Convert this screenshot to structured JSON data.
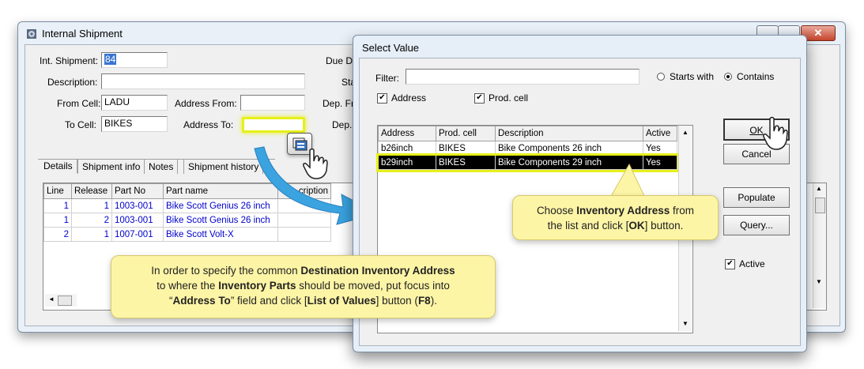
{
  "main_window": {
    "title": "Internal Shipment",
    "controls": {
      "minimize": "",
      "maximize": "",
      "close": "✕"
    },
    "fields": {
      "int_shipment_label": "Int. Shipment:",
      "int_shipment_value": "84",
      "description_label": "Description:",
      "description_value": "",
      "from_cell_label": "From Cell:",
      "from_cell_value": "LADU",
      "to_cell_label": "To Cell:",
      "to_cell_value": "BIKES",
      "address_from_label": "Address From:",
      "address_from_value": "",
      "address_to_label": "Address To:",
      "address_to_value": "",
      "due_date_label": "Due Da",
      "status_label": "Sta",
      "dep_from_label": "Dep. Fro",
      "dep_to_label": "Dep. T"
    },
    "tabs": [
      "Details",
      "Shipment info",
      "Notes",
      "Shipment history"
    ],
    "table": {
      "columns": [
        "Line",
        "Release",
        "Part No",
        "Part name",
        "cription"
      ],
      "rows": [
        {
          "line": "1",
          "release": "1",
          "part_no": "1003-001",
          "part_name": "Bike Scott Genius 26 inch"
        },
        {
          "line": "1",
          "release": "2",
          "part_no": "1003-001",
          "part_name": "Bike Scott Genius 26 inch"
        },
        {
          "line": "2",
          "release": "1",
          "part_no": "1007-001",
          "part_name": "Bike Scott Volt-X"
        }
      ]
    }
  },
  "dialog": {
    "title": "Select Value",
    "filter_label": "Filter:",
    "filter_value": "",
    "starts_with_label": "Starts with",
    "contains_label": "Contains",
    "address_check_label": "Address",
    "prod_cell_check_label": "Prod. cell",
    "columns": [
      "Address",
      "Prod. cell",
      "Description",
      "Active"
    ],
    "rows": [
      {
        "address": "b26inch",
        "prod_cell": "BIKES",
        "description": "Bike Components 26 inch",
        "active": "Yes"
      },
      {
        "address": "b29inch",
        "prod_cell": "BIKES",
        "description": "Bike Components 29 inch",
        "active": "Yes"
      }
    ],
    "buttons": {
      "ok": "OK",
      "cancel": "Cancel",
      "populate": "Populate",
      "query": "Query..."
    },
    "active_check_label": "Active"
  },
  "callouts": {
    "dialog_tip": {
      "line1_pre": "Choose ",
      "line1_bold": "Inventory Address",
      "line1_post": " from",
      "line2_pre": "the list and click [",
      "line2_bold": "OK",
      "line2_post": "] button."
    },
    "main_tip": {
      "line1_pre": "In order to specify the common ",
      "line1_bold": "Destination Inventory Address",
      "line2_pre": "to where the ",
      "line2_bold": "Inventory Parts",
      "line2_post": " should be moved, put focus into",
      "line3_q1": "“",
      "line3_bold": "Address To",
      "line3_mid": "” field and click [",
      "line3_bold2": "List of Values",
      "line3_mid2": "] button (",
      "line3_bold3": "F8",
      "line3_post": ")."
    }
  },
  "colors": {
    "selection": "#000000",
    "highlight": "#e6f01a",
    "callout": "#fdf5a6",
    "arrow": "#3aa3e0",
    "link": "#0000cc"
  }
}
